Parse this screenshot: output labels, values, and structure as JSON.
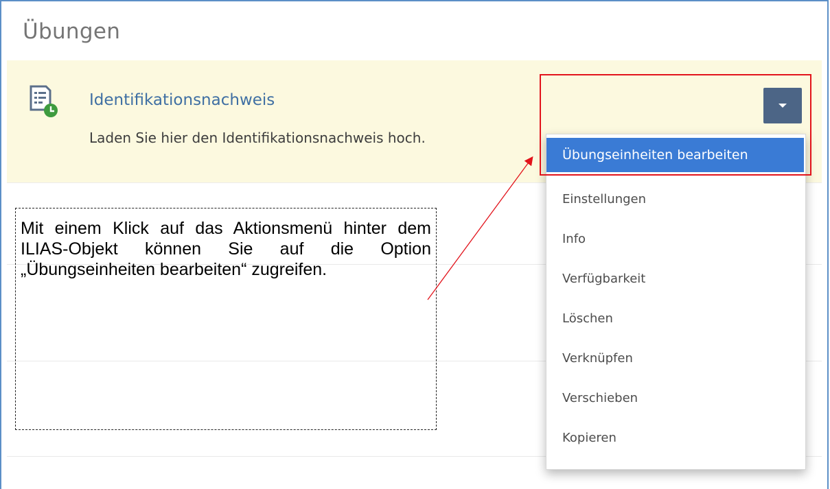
{
  "section": {
    "title": "Übungen"
  },
  "item": {
    "title": "Identifikationsnachweis",
    "description": "Laden Sie hier den Identifikationsnachweis hoch.",
    "icon": "exercise-clock-icon"
  },
  "actions_menu": {
    "items": [
      {
        "label": "Übungseinheiten bearbeiten",
        "active": true
      },
      {
        "label": "Einstellungen"
      },
      {
        "label": "Info"
      },
      {
        "label": "Verfügbarkeit"
      },
      {
        "label": "Löschen"
      },
      {
        "label": "Verknüpfen"
      },
      {
        "label": "Verschieben"
      },
      {
        "label": "Kopieren"
      }
    ]
  },
  "callout": {
    "text": "Mit einem Klick auf das Aktionsmenü hinter dem ILIAS-Objekt können Sie auf die Option „Übungseinheiten bearbeiten“ zugreifen."
  },
  "colors": {
    "row_highlight": "#fcf9df",
    "menu_active": "#3a7bd5",
    "dropdown_button": "#4c6586",
    "annotation_red": "#e2131b",
    "title_link": "#3f6fa3"
  }
}
